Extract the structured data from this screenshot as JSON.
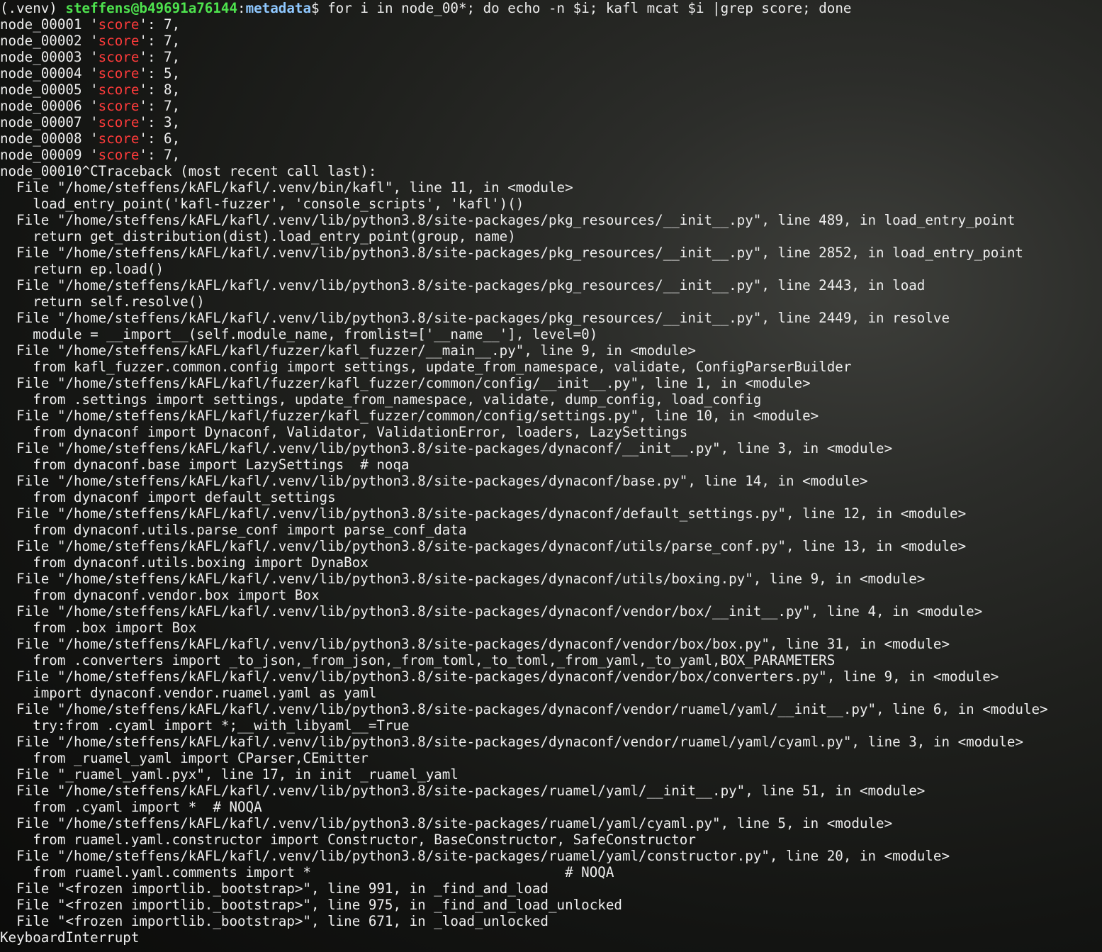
{
  "prompt": {
    "venv": "(.venv) ",
    "user_host": "steffens@b49691a76144",
    "sep": ":",
    "path": "metadata",
    "symbol": "$ ",
    "command": "for i in node_00*; do echo -n $i; kafl mcat $i |grep score; done"
  },
  "score_lines": [
    {
      "node": "node_00001 ",
      "pre": "'",
      "key": "score",
      "post": "': 7,"
    },
    {
      "node": "node_00002 ",
      "pre": "'",
      "key": "score",
      "post": "': 7,"
    },
    {
      "node": "node_00003 ",
      "pre": "'",
      "key": "score",
      "post": "': 7,"
    },
    {
      "node": "node_00004 ",
      "pre": "'",
      "key": "score",
      "post": "': 5,"
    },
    {
      "node": "node_00005 ",
      "pre": "'",
      "key": "score",
      "post": "': 8,"
    },
    {
      "node": "node_00006 ",
      "pre": "'",
      "key": "score",
      "post": "': 7,"
    },
    {
      "node": "node_00007 ",
      "pre": "'",
      "key": "score",
      "post": "': 3,"
    },
    {
      "node": "node_00008 ",
      "pre": "'",
      "key": "score",
      "post": "': 6,"
    },
    {
      "node": "node_00009 ",
      "pre": "'",
      "key": "score",
      "post": "': 7,"
    }
  ],
  "traceback_lines": [
    "node_00010^CTraceback (most recent call last):",
    "  File \"/home/steffens/kAFL/kafl/.venv/bin/kafl\", line 11, in <module>",
    "    load_entry_point('kafl-fuzzer', 'console_scripts', 'kafl')()",
    "  File \"/home/steffens/kAFL/kafl/.venv/lib/python3.8/site-packages/pkg_resources/__init__.py\", line 489, in load_entry_point",
    "    return get_distribution(dist).load_entry_point(group, name)",
    "  File \"/home/steffens/kAFL/kafl/.venv/lib/python3.8/site-packages/pkg_resources/__init__.py\", line 2852, in load_entry_point",
    "    return ep.load()",
    "  File \"/home/steffens/kAFL/kafl/.venv/lib/python3.8/site-packages/pkg_resources/__init__.py\", line 2443, in load",
    "    return self.resolve()",
    "  File \"/home/steffens/kAFL/kafl/.venv/lib/python3.8/site-packages/pkg_resources/__init__.py\", line 2449, in resolve",
    "    module = __import__(self.module_name, fromlist=['__name__'], level=0)",
    "  File \"/home/steffens/kAFL/kafl/fuzzer/kafl_fuzzer/__main__.py\", line 9, in <module>",
    "    from kafl_fuzzer.common.config import settings, update_from_namespace, validate, ConfigParserBuilder",
    "  File \"/home/steffens/kAFL/kafl/fuzzer/kafl_fuzzer/common/config/__init__.py\", line 1, in <module>",
    "    from .settings import settings, update_from_namespace, validate, dump_config, load_config",
    "  File \"/home/steffens/kAFL/kafl/fuzzer/kafl_fuzzer/common/config/settings.py\", line 10, in <module>",
    "    from dynaconf import Dynaconf, Validator, ValidationError, loaders, LazySettings",
    "  File \"/home/steffens/kAFL/kafl/.venv/lib/python3.8/site-packages/dynaconf/__init__.py\", line 3, in <module>",
    "    from dynaconf.base import LazySettings  # noqa",
    "  File \"/home/steffens/kAFL/kafl/.venv/lib/python3.8/site-packages/dynaconf/base.py\", line 14, in <module>",
    "    from dynaconf import default_settings",
    "  File \"/home/steffens/kAFL/kafl/.venv/lib/python3.8/site-packages/dynaconf/default_settings.py\", line 12, in <module>",
    "    from dynaconf.utils.parse_conf import parse_conf_data",
    "  File \"/home/steffens/kAFL/kafl/.venv/lib/python3.8/site-packages/dynaconf/utils/parse_conf.py\", line 13, in <module>",
    "    from dynaconf.utils.boxing import DynaBox",
    "  File \"/home/steffens/kAFL/kafl/.venv/lib/python3.8/site-packages/dynaconf/utils/boxing.py\", line 9, in <module>",
    "    from dynaconf.vendor.box import Box",
    "  File \"/home/steffens/kAFL/kafl/.venv/lib/python3.8/site-packages/dynaconf/vendor/box/__init__.py\", line 4, in <module>",
    "    from .box import Box",
    "  File \"/home/steffens/kAFL/kafl/.venv/lib/python3.8/site-packages/dynaconf/vendor/box/box.py\", line 31, in <module>",
    "    from .converters import _to_json,_from_json,_from_toml,_to_toml,_from_yaml,_to_yaml,BOX_PARAMETERS",
    "  File \"/home/steffens/kAFL/kafl/.venv/lib/python3.8/site-packages/dynaconf/vendor/box/converters.py\", line 9, in <module>",
    "    import dynaconf.vendor.ruamel.yaml as yaml",
    "  File \"/home/steffens/kAFL/kafl/.venv/lib/python3.8/site-packages/dynaconf/vendor/ruamel/yaml/__init__.py\", line 6, in <module>",
    "    try:from .cyaml import *;__with_libyaml__=True",
    "  File \"/home/steffens/kAFL/kafl/.venv/lib/python3.8/site-packages/dynaconf/vendor/ruamel/yaml/cyaml.py\", line 3, in <module>",
    "    from _ruamel_yaml import CParser,CEmitter",
    "  File \"_ruamel_yaml.pyx\", line 17, in init _ruamel_yaml",
    "  File \"/home/steffens/kAFL/kafl/.venv/lib/python3.8/site-packages/ruamel/yaml/__init__.py\", line 51, in <module>",
    "    from .cyaml import *  # NOQA",
    "  File \"/home/steffens/kAFL/kafl/.venv/lib/python3.8/site-packages/ruamel/yaml/cyaml.py\", line 5, in <module>",
    "    from ruamel.yaml.constructor import Constructor, BaseConstructor, SafeConstructor",
    "  File \"/home/steffens/kAFL/kafl/.venv/lib/python3.8/site-packages/ruamel/yaml/constructor.py\", line 20, in <module>",
    "    from ruamel.yaml.comments import *                               # NOQA",
    "  File \"<frozen importlib._bootstrap>\", line 991, in _find_and_load",
    "  File \"<frozen importlib._bootstrap>\", line 975, in _find_and_load_unlocked",
    "  File \"<frozen importlib._bootstrap>\", line 671, in _load_unlocked",
    "KeyboardInterrupt"
  ],
  "colors": {
    "text": "#eeeeee",
    "user_host": "#4ee34e",
    "path": "#8fc8ff",
    "highlight": "#ff3b3b"
  }
}
